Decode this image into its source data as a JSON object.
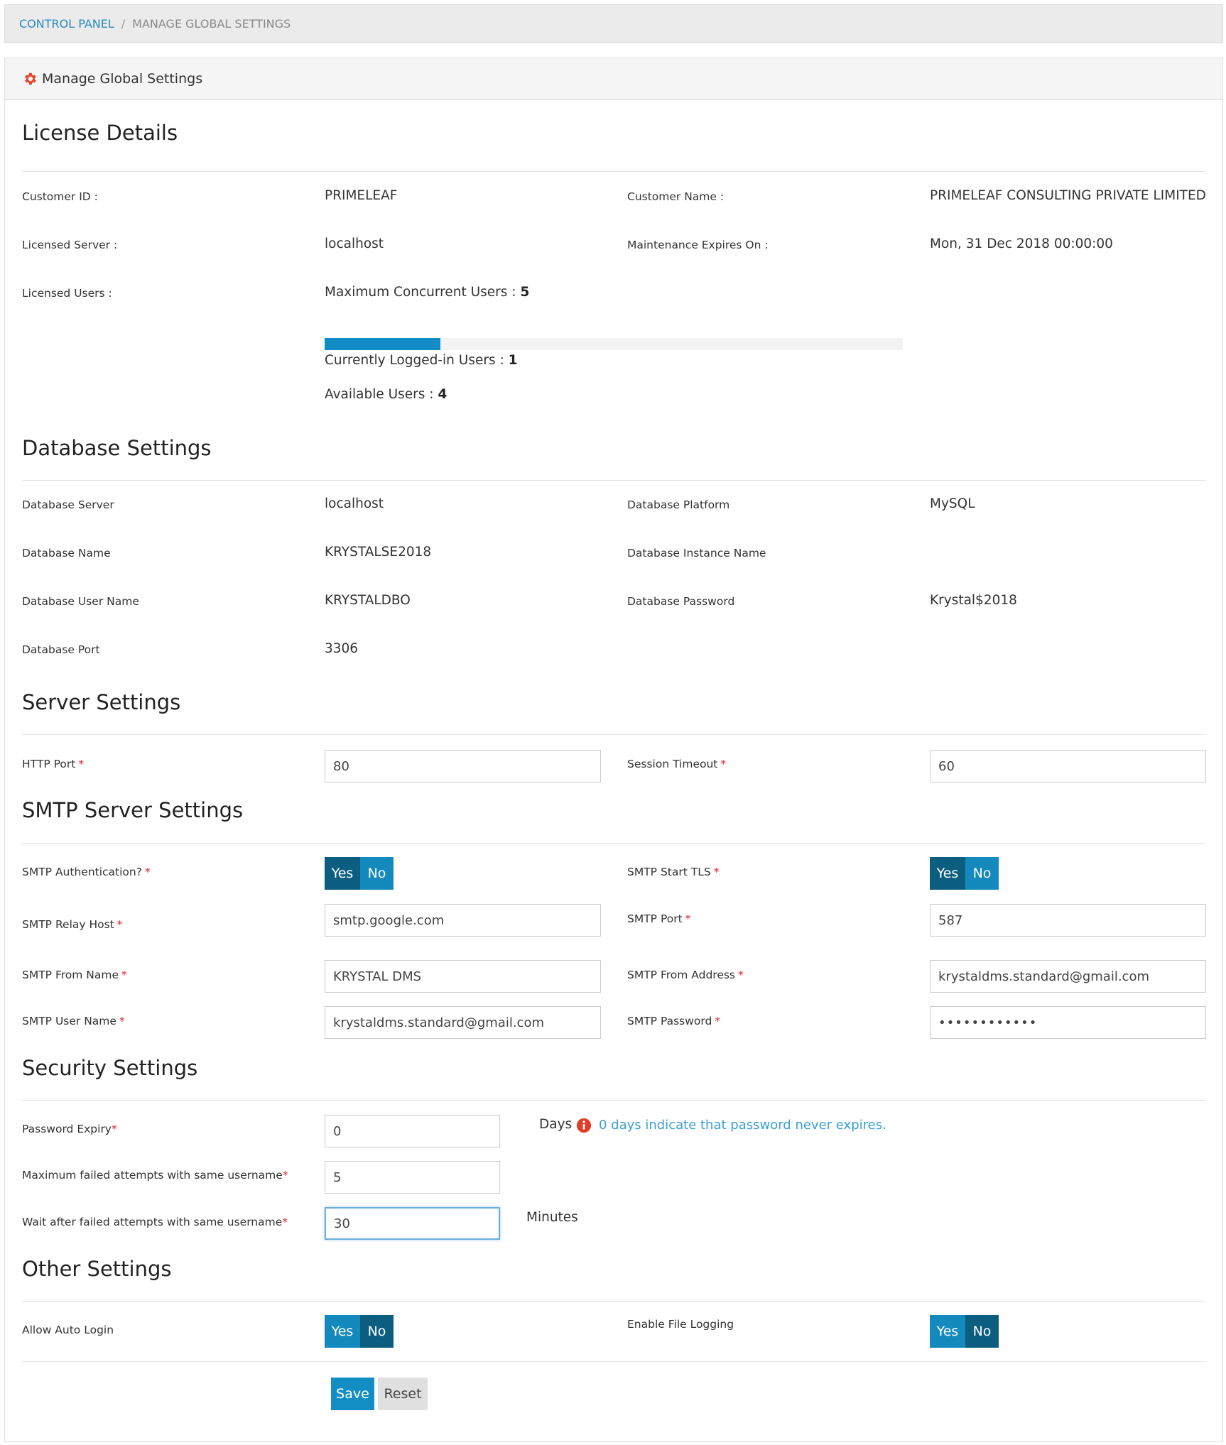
{
  "breadcrumb": {
    "root": "CONTROL PANEL",
    "separator": "/",
    "current": "MANAGE GLOBAL SETTINGS"
  },
  "panel": {
    "title": "Manage Global Settings"
  },
  "license": {
    "title": "License Details",
    "customer_id_label": "Customer ID :",
    "customer_id": "PRIMELEAF",
    "customer_name_label": "Customer Name :",
    "customer_name": "PRIMELEAF CONSULTING PRIVATE LIMITED",
    "licensed_server_label": "Licensed Server :",
    "licensed_server": "localhost",
    "maintenance_label": "Maintenance Expires On :",
    "maintenance": "Mon, 31 Dec 2018 00:00:00",
    "licensed_users_label": "Licensed Users :",
    "max_users_label": "Maximum Concurrent Users :",
    "max_users": "5",
    "logged_in_label": "Currently Logged-in Users :",
    "logged_in": "1",
    "available_label": "Available Users :",
    "available": "4",
    "usage_fraction": 0.2
  },
  "database": {
    "title": "Database Settings",
    "server_label": "Database Server",
    "server": "localhost",
    "platform_label": "Database Platform",
    "platform": "MySQL",
    "name_label": "Database Name",
    "name": "KRYSTALSE2018",
    "instance_label": "Database Instance Name",
    "instance": "",
    "user_label": "Database User Name",
    "user": "KRYSTALDBO",
    "password_label": "Database Password",
    "password": "Krystal$2018",
    "port_label": "Database Port",
    "port": "3306"
  },
  "server": {
    "title": "Server Settings",
    "http_port_label": "HTTP Port",
    "http_port": "80",
    "session_timeout_label": "Session Timeout",
    "session_timeout": "60"
  },
  "smtp": {
    "title": "SMTP Server Settings",
    "auth_label": "SMTP Authentication?",
    "start_tls_label": "SMTP Start TLS",
    "relay_host_label": "SMTP Relay Host",
    "relay_host": "smtp.google.com",
    "port_label": "SMTP Port",
    "port": "587",
    "from_name_label": "SMTP From Name",
    "from_name": "KRYSTAL DMS",
    "from_address_label": "SMTP From Address",
    "from_address": "krystaldms.standard@gmail.com",
    "user_name_label": "SMTP User Name",
    "user_name": "krystaldms.standard@gmail.com",
    "password_label": "SMTP Password",
    "password_masked": "••••••••••••"
  },
  "security": {
    "title": "Security Settings",
    "expiry_label": "Password Expiry",
    "expiry": "0",
    "days_unit": "Days",
    "expiry_hint": "0 days indicate that password never expires.",
    "max_failed_label": "Maximum failed attempts with same username",
    "max_failed": "5",
    "wait_label": "Wait after failed attempts with same username",
    "wait": "30",
    "minutes_unit": "Minutes"
  },
  "other": {
    "title": "Other Settings",
    "auto_login_label": "Allow Auto Login",
    "file_logging_label": "Enable File Logging"
  },
  "toggle": {
    "yes": "Yes",
    "no": "No"
  },
  "required_mark": "*",
  "actions": {
    "save": "Save",
    "reset": "Reset"
  },
  "colors": {
    "accent": "#1389bd",
    "accent_dark": "#0c5e80",
    "required": "#d9232d",
    "link": "#2a8ab8"
  }
}
